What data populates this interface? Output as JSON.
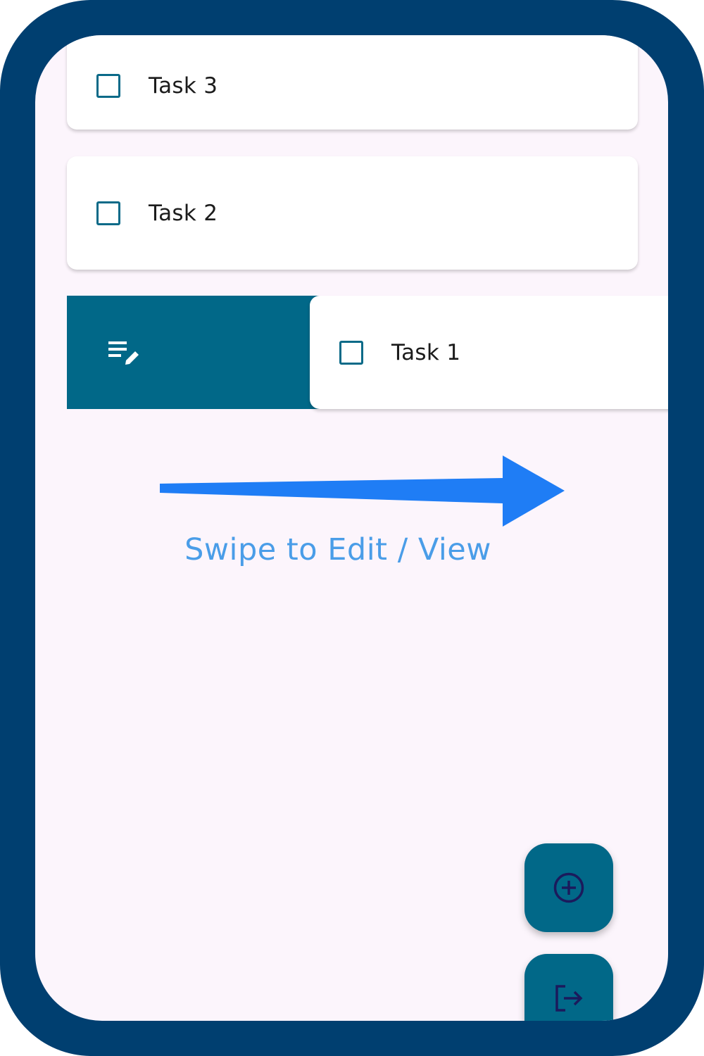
{
  "tasks": [
    {
      "label": "Task 3",
      "checked": false
    },
    {
      "label": "Task 2",
      "checked": false
    },
    {
      "label": "Task 1",
      "checked": false
    }
  ],
  "swipe_action": {
    "icon": "edit-notes-icon",
    "color": "#016888"
  },
  "hint": {
    "text": "Swipe to Edit / View",
    "arrow": "arrow-right-icon"
  },
  "fabs": [
    {
      "icon": "add-circle-icon"
    },
    {
      "icon": "logout-icon"
    }
  ],
  "colors": {
    "frame": "#003f70",
    "background": "#fcf5fc",
    "accent": "#016888",
    "hint": "#4a9de8",
    "arrow": "#1f7df5"
  }
}
